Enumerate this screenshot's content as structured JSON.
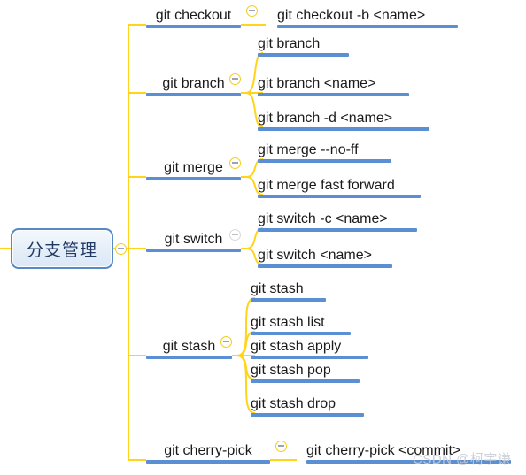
{
  "diagram": {
    "type": "mind-map",
    "title": "分支管理",
    "colors": {
      "branch_line": "#FFD41A",
      "topic_underline": "#5B8FD3",
      "root_border": "#5789C4",
      "root_text": "#1F3864",
      "root_fill": "#E4EEF8",
      "watermark": "#c9cdd4"
    },
    "root": {
      "label": "分支管理",
      "toggle_icon": "collapse-circle-icon"
    },
    "branches": [
      {
        "label": "git checkout",
        "toggle_icon": "collapse-circle-icon",
        "children": [
          {
            "label": "git checkout -b <name>"
          }
        ]
      },
      {
        "label": "git branch",
        "toggle_icon": "collapse-circle-icon",
        "children": [
          {
            "label": "git branch"
          },
          {
            "label": "git branch <name>"
          },
          {
            "label": "git branch -d <name>"
          }
        ]
      },
      {
        "label": "git merge",
        "toggle_icon": "collapse-circle-icon",
        "children": [
          {
            "label": "git merge --no-ff"
          },
          {
            "label": "git merge fast forward"
          }
        ]
      },
      {
        "label": "git switch",
        "toggle_icon": "collapse-circle-icon",
        "children": [
          {
            "label": "git switch -c <name>"
          },
          {
            "label": "git switch <name>"
          }
        ]
      },
      {
        "label": "git stash",
        "toggle_icon": "collapse-circle-icon",
        "children": [
          {
            "label": "git stash"
          },
          {
            "label": "git stash list"
          },
          {
            "label": "git stash apply"
          },
          {
            "label": "git stash pop"
          },
          {
            "label": "git stash drop"
          }
        ]
      },
      {
        "label": "git cherry-pick",
        "toggle_icon": "collapse-circle-icon",
        "children": [
          {
            "label": "git cherry-pick <commit>"
          }
        ]
      }
    ],
    "watermark": "CSDN @柯宇谦"
  }
}
